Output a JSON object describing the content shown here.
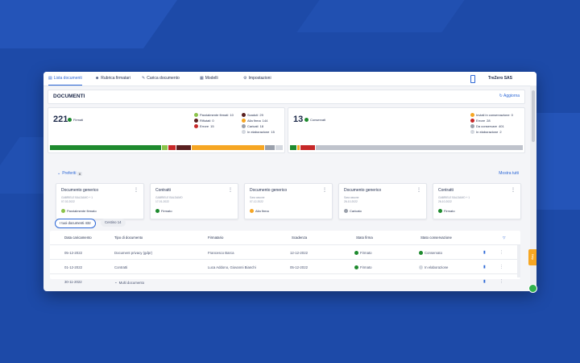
{
  "colors": {
    "accent": "#2c67d6",
    "green": "#1e8a2e",
    "red": "#c62828",
    "orange": "#f6a623",
    "grey": "#bfc3cc",
    "maroon": "#5a2020"
  },
  "nav": {
    "tabs": [
      {
        "label": "Lista documenti",
        "icon": "document-list-icon"
      },
      {
        "label": "Rubrica firmatari",
        "icon": "users-icon"
      },
      {
        "label": "Carica documento",
        "icon": "pen-icon"
      },
      {
        "label": "Modelli",
        "icon": "template-icon"
      },
      {
        "label": "Impostazioni",
        "icon": "gear-icon"
      }
    ],
    "company": "TreZero SAS"
  },
  "header": {
    "title": "DOCUMENTI",
    "refresh": "Aggiorna"
  },
  "signed": {
    "count": "221",
    "label": "Firmati",
    "legend_left": [
      {
        "label": "Parzialmente firmati",
        "value": "10",
        "color": "#8bc34a"
      },
      {
        "label": "Rifiutati",
        "value": "0",
        "color": "#5a2020"
      },
      {
        "label": "Errore",
        "value": "15",
        "color": "#c62828"
      }
    ],
    "legend_right": [
      {
        "label": "Scaduti",
        "value": "29",
        "color": "#5a2020"
      },
      {
        "label": "Alla firma",
        "value": "144",
        "color": "#f6a623"
      },
      {
        "label": "Caricati",
        "value": "18",
        "color": "#9aa0ab"
      },
      {
        "label": "In elaborazione",
        "value": "15",
        "color": "#d4d8df"
      }
    ]
  },
  "conserved": {
    "count": "13",
    "label": "Conservati",
    "legend": [
      {
        "label": "Inviati in conservazione",
        "value": "0",
        "color": "#f6a623"
      },
      {
        "label": "Errore",
        "value": "28",
        "color": "#c62828"
      },
      {
        "label": "Da conservare",
        "value": "401",
        "color": "#9aa0ab"
      },
      {
        "label": "In elaborazione",
        "value": "2",
        "color": "#d4d8df"
      }
    ]
  },
  "favorites": {
    "title": "Preferiti",
    "count": "6",
    "show_all": "Mostra tutti",
    "cards": [
      {
        "name": "Documento generico",
        "line1": "GABRIELE BALDAMO + 1",
        "line2": "07-02-2022",
        "status": "Parzialmente firmato",
        "color": "#8bc34a"
      },
      {
        "name": "Contratti",
        "line1": "GABRIELE BALDAMO",
        "line2": "17-01-2022",
        "status": "Firmato",
        "color": "#1e8a2e"
      },
      {
        "name": "Documento generico",
        "line1": "Sara assone",
        "line2": "07-12-2022",
        "status": "Alla firma",
        "color": "#f6a623"
      },
      {
        "name": "Documento generico",
        "line1": "Sara assone",
        "line2": "26-10-2022",
        "status": "Caricato",
        "color": "#9aa0ab"
      },
      {
        "name": "Contratti",
        "line1": "GABRIELE BALDAMO + 1",
        "line2": "26-10-2022",
        "status": "Firmato",
        "color": "#1e8a2e"
      }
    ]
  },
  "filters": {
    "all": "I tuoi documenti 432",
    "trash": "Cestino 14"
  },
  "table": {
    "headers": [
      "Data caricamento",
      "Tipo di documento",
      "Firmatario",
      "Scadenza",
      "Stato firma",
      "Stato conservazione"
    ],
    "rows": [
      {
        "date": "05-12-2022",
        "type": "Document privacy (gdpr)",
        "signer": "Francesco Barca",
        "due": "12-12-2022",
        "sign": "Firmato",
        "sign_color": "#1e8a2e",
        "cons": "Conservato",
        "cons_color": "#1e8a2e"
      },
      {
        "date": "01-12-2022",
        "type": "Contratti",
        "signer": "Luca Addono, Giovanni Bianchi",
        "due": "05-12-2022",
        "sign": "Firmato",
        "sign_color": "#1e8a2e",
        "cons": "In elaborazione",
        "cons_color": "#d4d8df"
      },
      {
        "date": "30-11-2022",
        "type": "Multi documento",
        "signer": "",
        "due": "",
        "sign": "",
        "sign_color": "",
        "cons": "",
        "cons_color": ""
      }
    ]
  },
  "help": "Help"
}
